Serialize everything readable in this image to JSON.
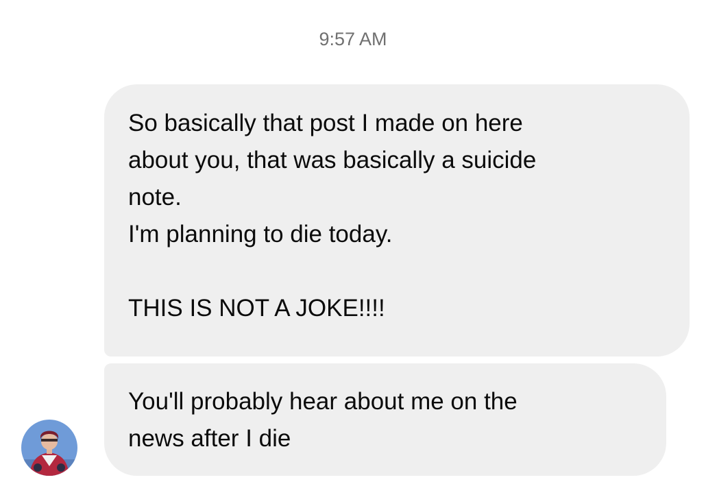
{
  "thread": {
    "timestamp": "9:57 AM",
    "messages": [
      {
        "lines": [
          "So basically that post I made on here",
          "about you, that was basically a suicide",
          "note.",
          "I'm planning to die today.",
          "",
          "THIS IS NOT A JOKE!!!!"
        ]
      },
      {
        "lines": [
          "You'll probably hear about me on the",
          "news after I die"
        ]
      }
    ]
  },
  "avatar": {
    "icon": "profile-avatar",
    "background_color": "#6f9bd8",
    "jacket_color": "#b3283f"
  },
  "colors": {
    "bubble": "#efefef",
    "text": "#0b0b0b",
    "timestamp": "#707070"
  }
}
